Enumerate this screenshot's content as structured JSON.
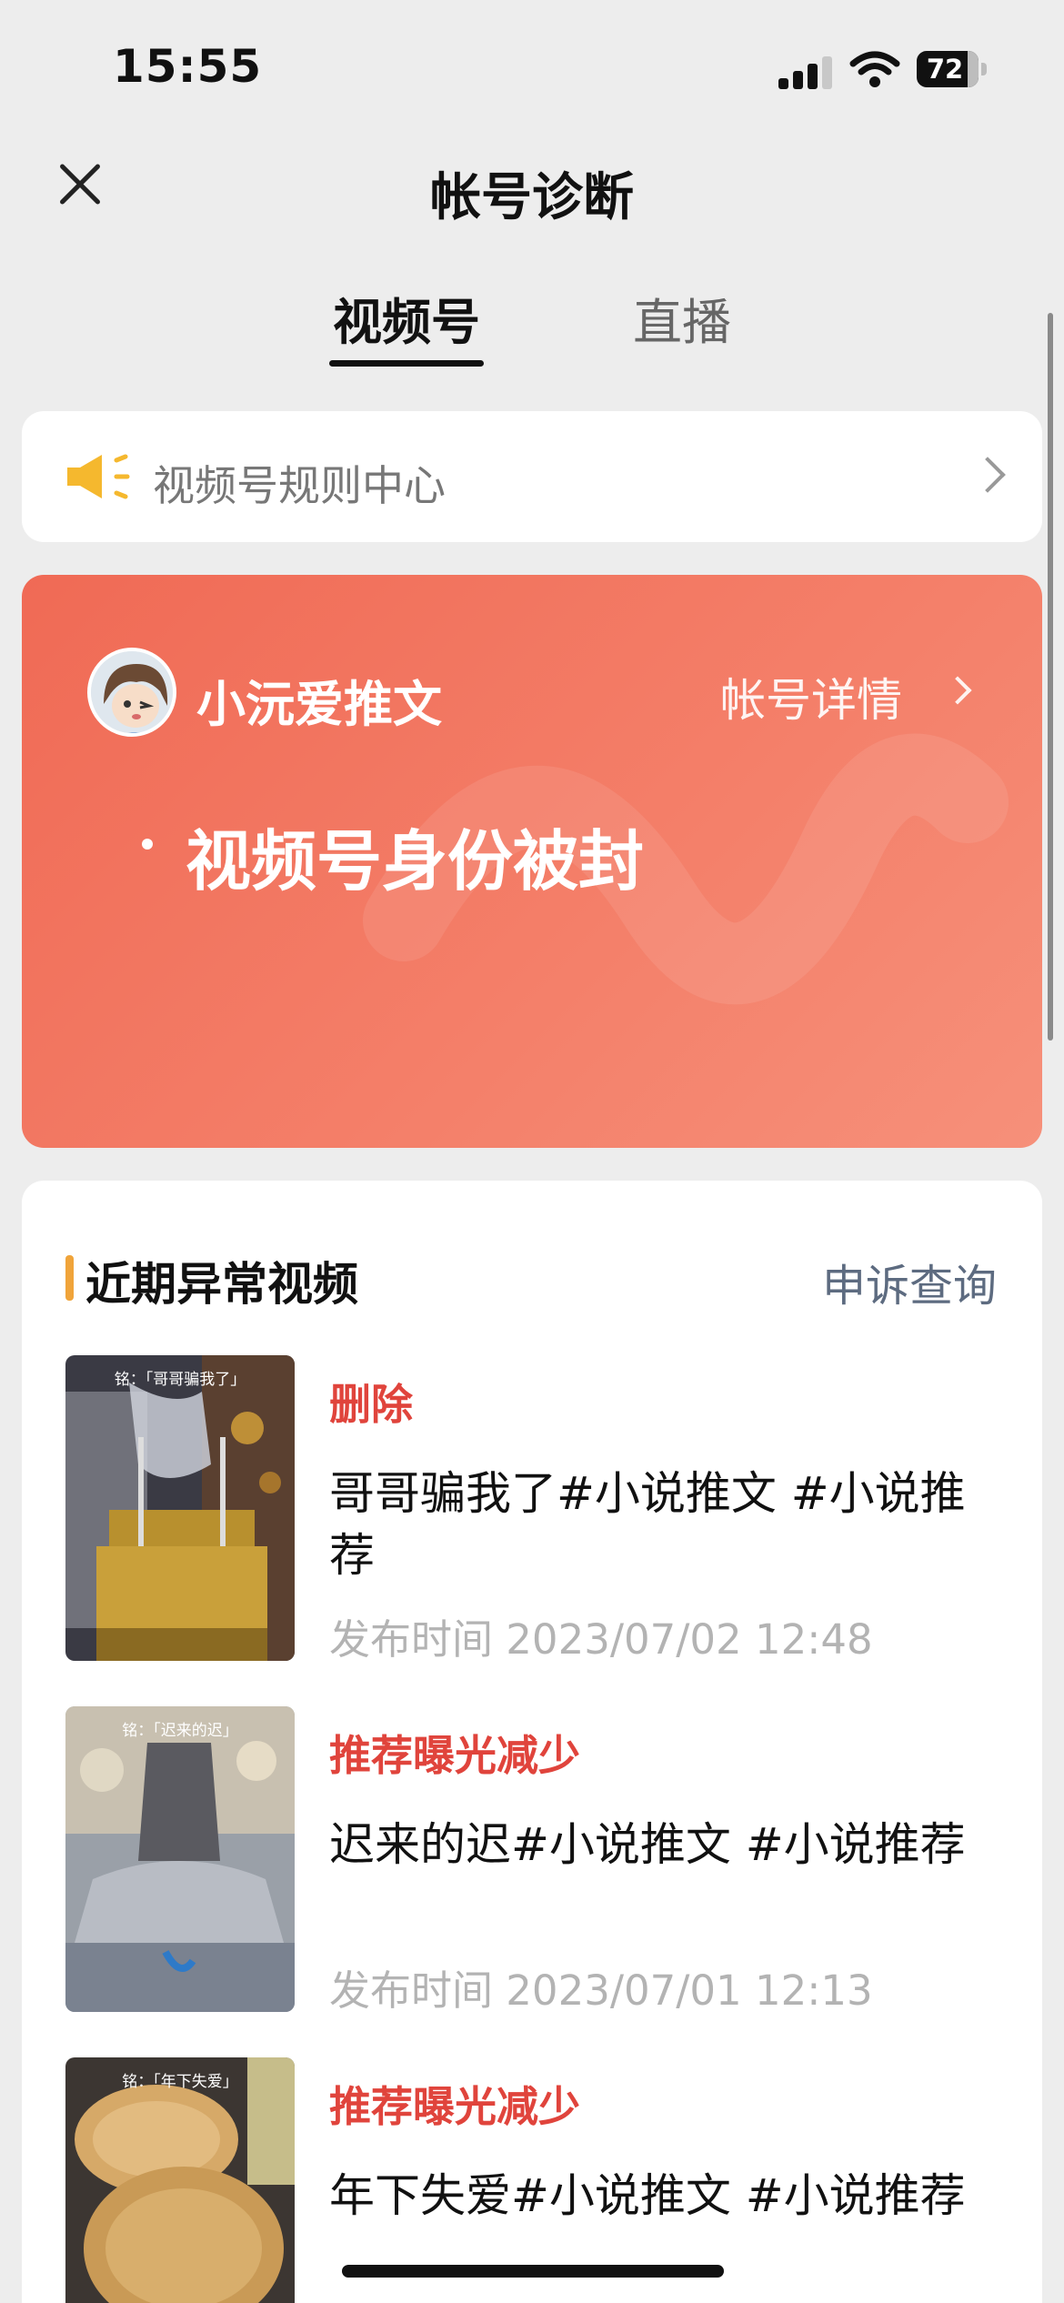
{
  "status_bar": {
    "time": "15:55",
    "battery": "72"
  },
  "nav": {
    "title": "帐号诊断"
  },
  "tabs": [
    {
      "label": "视频号",
      "active": true
    },
    {
      "label": "直播",
      "active": false
    }
  ],
  "rules_banner": {
    "label": "视频号规则中心",
    "icon": "speaker-icon"
  },
  "account": {
    "name": "小沅爱推文",
    "detail_link": "帐号详情",
    "status": "视频号身份被封",
    "card_color": "#f06a55"
  },
  "abnormal_videos": {
    "title": "近期异常视频",
    "appeal_link": "申诉查询",
    "items": [
      {
        "thumb_caption": "铭：「哥哥骗我了」",
        "status": "删除",
        "title": "哥哥骗我了#小说推文 #小说推荐",
        "published": "发布时间 2023/07/02 12:48"
      },
      {
        "thumb_caption": "铭：「迟来的迟」",
        "status": "推荐曝光减少",
        "title": "迟来的迟#小说推文 #小说推荐",
        "published": "发布时间 2023/07/01 12:13"
      },
      {
        "thumb_caption": "铭：「年下失爱」",
        "status": "推荐曝光减少",
        "title": "年下失爱#小说推文 #小说推荐",
        "published": ""
      }
    ]
  },
  "colors": {
    "accent_red": "#e0443c",
    "section_bar": "#f0a43a",
    "link_gray": "#5d6b80"
  }
}
